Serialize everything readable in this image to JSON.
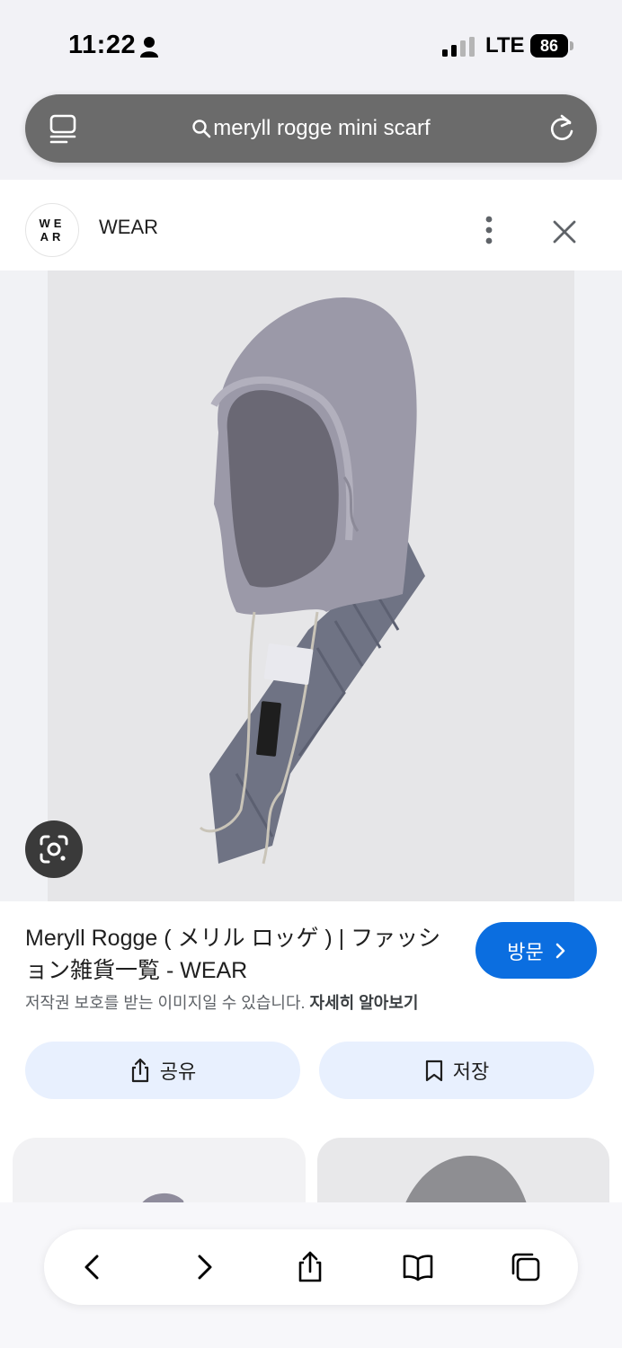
{
  "status": {
    "time": "11:22",
    "network": "LTE",
    "battery": "86"
  },
  "url_bar": {
    "query": "meryll rogge mini scarf"
  },
  "source": {
    "logo_text": "WEAR",
    "name": "WEAR"
  },
  "result": {
    "title": "Meryll Rogge ( メリル ロッゲ ) | ファッション雑貨一覧 - WEAR",
    "visit_label": "방문",
    "copyright_notice": "저작권 보호를 받는 이미지일 수 있습니다.",
    "learn_more": "자세히 알아보기",
    "share_label": "공유",
    "save_label": "저장"
  },
  "colors": {
    "accent": "#0b6ee0",
    "action_bg": "#e8f0fe"
  },
  "icons": [
    "person-icon",
    "signal-icon",
    "battery-icon",
    "tabs-menu-icon",
    "search-icon",
    "reload-icon",
    "more-vert-icon",
    "close-icon",
    "lens-icon",
    "chevron-right-icon",
    "share-icon",
    "bookmark-icon",
    "back-icon",
    "forward-icon",
    "book-icon",
    "tabs-icon"
  ]
}
